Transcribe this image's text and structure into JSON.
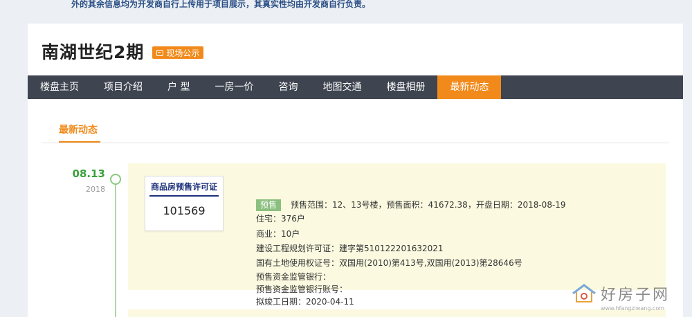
{
  "notice": "外的其余信息均为开发商自行上传用于项目展示，其真实性均由开发商自行负责。",
  "header": {
    "title": "南湖世纪2期",
    "badge_label": "现场公示"
  },
  "nav": {
    "items": [
      "楼盘主页",
      "项目介绍",
      "户 型",
      "一房一价",
      "咨询",
      "地图交通",
      "楼盘相册",
      "最新动态"
    ],
    "active_index": 7
  },
  "tab": {
    "label": "最新动态"
  },
  "timeline": [
    {
      "date": "08.13",
      "year": "2018",
      "certificate": {
        "title": "商品房预售许可证",
        "number": "101569"
      },
      "tag": "预售",
      "lines": [
        "预售范围：12、13号楼，预售面积：41672.38，开盘日期：2018-08-19",
        "住宅：376户",
        "商业：10户",
        "建设工程规划许可证：建字第510122201632021",
        "国有土地使用权证号：双国用(2010)第413号,双国用(2013)第28646号",
        "预售资金监管银行：",
        "预售资金监管银行账号：",
        "拟竣工日期：2020-04-11"
      ]
    }
  ],
  "watermark": {
    "text": "好房子网",
    "url": "www.hfangziwang.com"
  },
  "colors": {
    "accent": "#f18a1a",
    "nav_bg": "#3e4450",
    "timeline_green": "#3aa13a",
    "entry_bg": "#fbfae0"
  }
}
